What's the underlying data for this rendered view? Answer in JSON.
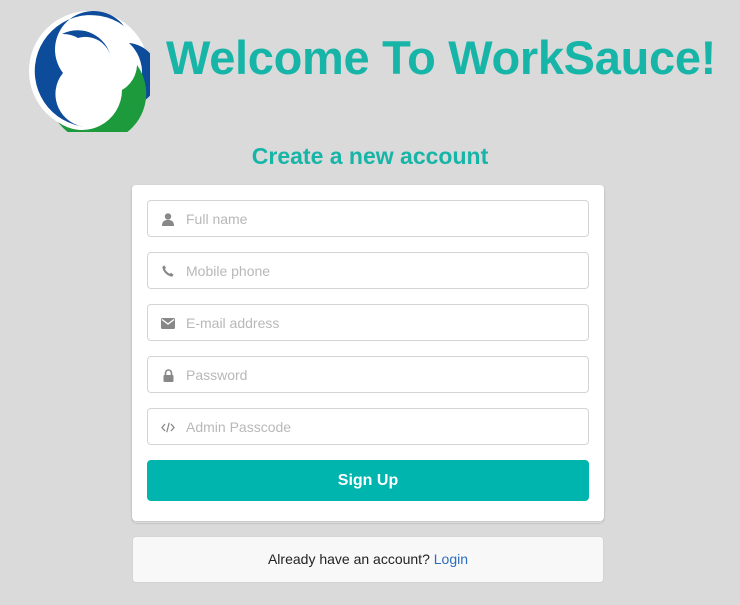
{
  "header": {
    "logo_icon": "worksauce-swirl-logo-icon",
    "title": "Welcome To WorkSauce!"
  },
  "form": {
    "heading": "Create a new account",
    "fields": [
      {
        "icon": "user-icon",
        "placeholder": "Full name",
        "value": ""
      },
      {
        "icon": "phone-icon",
        "placeholder": "Mobile phone",
        "value": ""
      },
      {
        "icon": "envelope-icon",
        "placeholder": "E-mail address",
        "value": ""
      },
      {
        "icon": "lock-icon",
        "placeholder": "Password",
        "value": ""
      },
      {
        "icon": "code-icon",
        "placeholder": "Admin Passcode",
        "value": ""
      }
    ],
    "submit_label": "Sign Up"
  },
  "footer": {
    "prompt": "Already have an account?",
    "login_label": "Login"
  },
  "colors": {
    "accent": "#00b5ad",
    "title": "#17b5a8",
    "link": "#2c6ebd",
    "logo_blue": "#0d4c9a",
    "logo_green": "#1c9a3c"
  }
}
